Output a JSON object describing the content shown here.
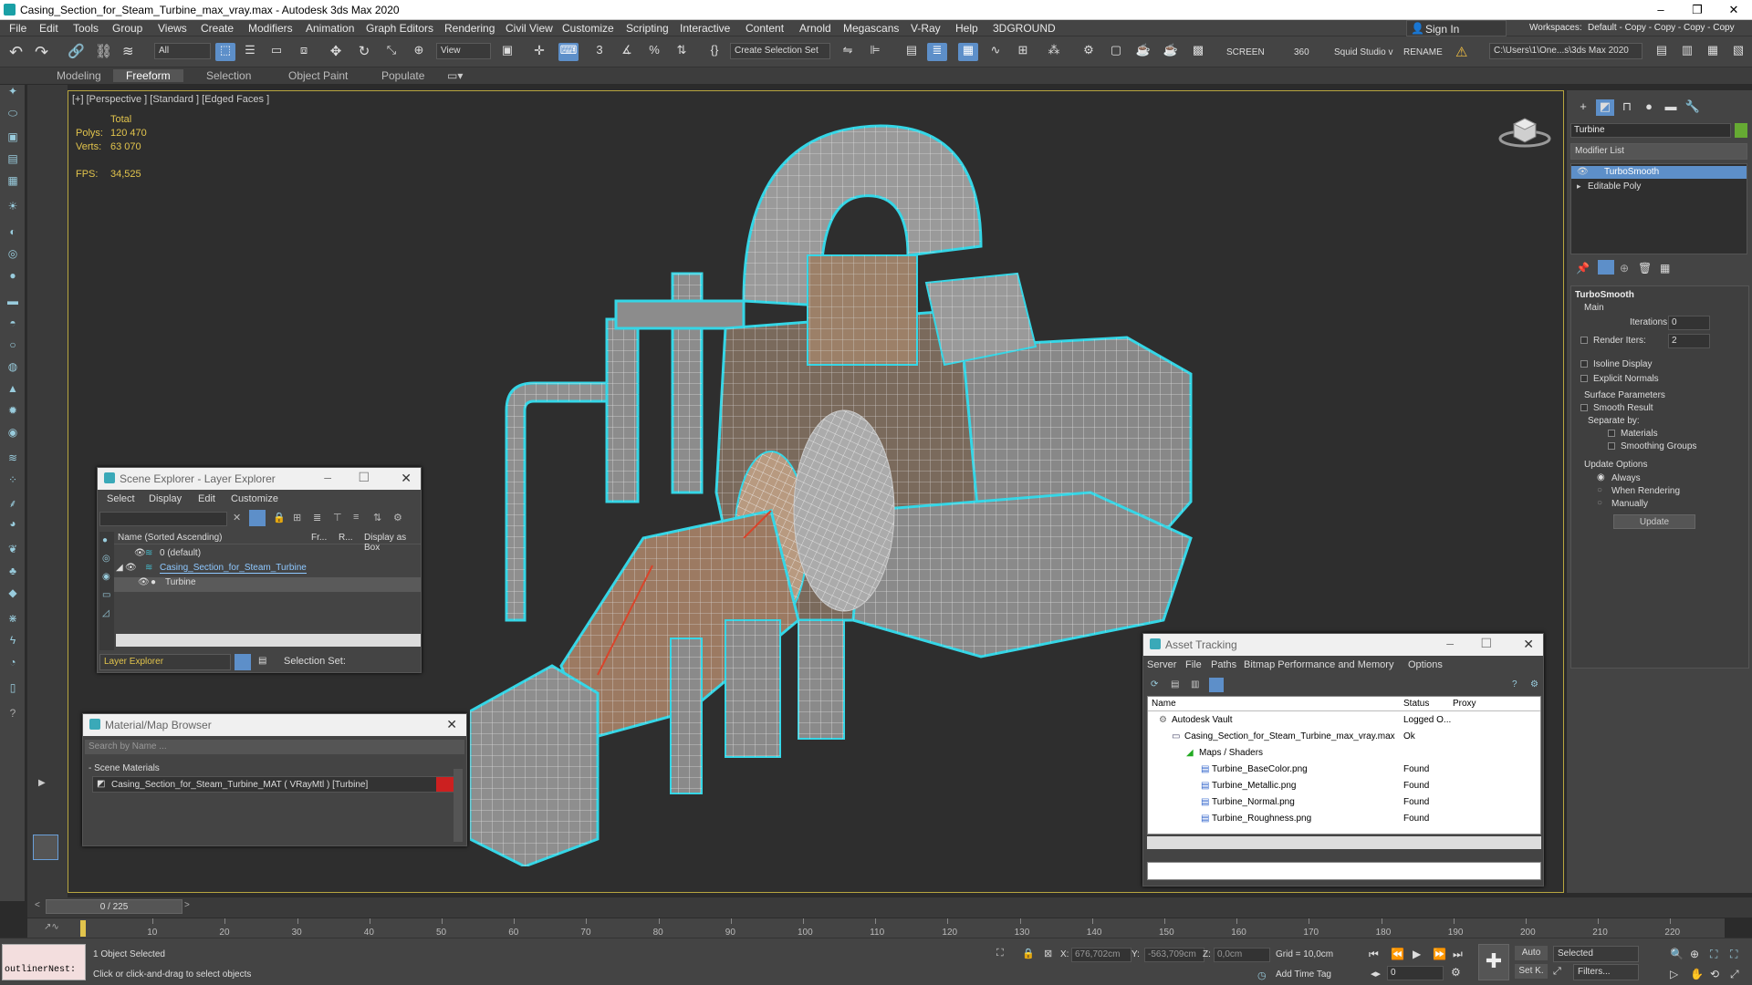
{
  "window": {
    "title": "Casing_Section_for_Steam_Turbine_max_vray.max - Autodesk 3ds Max 2020",
    "min": "–",
    "max": "❐",
    "close": "✕"
  },
  "menu": [
    "File",
    "Edit",
    "Tools",
    "Group",
    "Views",
    "Create",
    "Modifiers",
    "Animation",
    "Graph Editors",
    "Rendering",
    "Civil View",
    "Customize",
    "Scripting",
    "Interactive",
    "Content",
    "Arnold",
    "Megascans",
    "V-Ray",
    "Help",
    "3DGROUND"
  ],
  "account": {
    "sign_in": "Sign In",
    "workspaces_label": "Workspaces:",
    "workspace_value": "Default - Copy - Copy - Copy - Copy"
  },
  "toolbar": {
    "filter_value": "All",
    "view_value": "View",
    "selection_set": "Create Selection Set",
    "screen": "SCREEN",
    "num360": "360",
    "studio": "Squid Studio v",
    "rename": "RENAME",
    "path": "C:\\Users\\1\\One...s\\3ds Max 2020"
  },
  "ribbon": [
    "Modeling",
    "Freeform",
    "Selection",
    "Object Paint",
    "Populate"
  ],
  "viewport": {
    "label": "[+] [Perspective ] [Standard ] [Edged Faces ]",
    "total_label": "Total",
    "polys_label": "Polys:",
    "polys_value": "120 470",
    "verts_label": "Verts:",
    "verts_value": "63 070",
    "fps_label": "FPS:",
    "fps_value": "34,525"
  },
  "command_panel": {
    "object_name": "Turbine",
    "modifier_list": "Modifier List",
    "stack": [
      "TurboSmooth",
      "Editable Poly"
    ],
    "rollout_title": "TurboSmooth",
    "main_label": "Main",
    "iterations_label": "Iterations:",
    "iterations_value": "0",
    "render_iters_label": "Render Iters:",
    "render_iters_value": "2",
    "isoline": "Isoline Display",
    "explicit": "Explicit Normals",
    "surface_params": "Surface Parameters",
    "smooth_result": "Smooth Result",
    "separate_by": "Separate by:",
    "materials": "Materials",
    "smoothing_groups": "Smoothing Groups",
    "update_options": "Update Options",
    "always": "Always",
    "when_rendering": "When Rendering",
    "manually": "Manually",
    "update_btn": "Update"
  },
  "scene_explorer": {
    "title": "Scene Explorer - Layer Explorer",
    "menus": [
      "Select",
      "Display",
      "Edit",
      "Customize"
    ],
    "col_name": "Name (Sorted Ascending)",
    "col_fr": "Fr...",
    "col_r": "R...",
    "col_box": "Display as Box",
    "rows": [
      "0 (default)",
      "Casing_Section_for_Steam_Turbine",
      "Turbine"
    ],
    "footer_dd": "Layer Explorer",
    "selection_set": "Selection Set:"
  },
  "material_browser": {
    "title": "Material/Map Browser",
    "search_placeholder": "Search by Name ...",
    "section": "- Scene Materials",
    "item": "Casing_Section_for_Steam_Turbine_MAT  ( VRayMtl )  [Turbine]"
  },
  "asset_tracking": {
    "title": "Asset Tracking",
    "menus": [
      "Server",
      "File",
      "Paths",
      "Bitmap Performance and Memory",
      "Options"
    ],
    "col_name": "Name",
    "col_status": "Status",
    "col_proxy": "Proxy",
    "rows": [
      {
        "name": "Autodesk Vault",
        "status": "Logged O..."
      },
      {
        "name": "Casing_Section_for_Steam_Turbine_max_vray.max",
        "status": "Ok"
      },
      {
        "name": "Maps / Shaders",
        "status": ""
      },
      {
        "name": "Turbine_BaseColor.png",
        "status": "Found"
      },
      {
        "name": "Turbine_Metallic.png",
        "status": "Found"
      },
      {
        "name": "Turbine_Normal.png",
        "status": "Found"
      },
      {
        "name": "Turbine_Roughness.png",
        "status": "Found"
      }
    ]
  },
  "timeline": {
    "frame": "0 / 225",
    "ticks": [
      "10",
      "20",
      "30",
      "40",
      "50",
      "60",
      "70",
      "80",
      "90",
      "100",
      "110",
      "120",
      "130",
      "140",
      "150",
      "160",
      "170",
      "180",
      "190",
      "200",
      "210",
      "220"
    ]
  },
  "status": {
    "listener": "outlinerNest:",
    "selected": "1 Object Selected",
    "hint": "Click or click-and-drag to select objects",
    "x_label": "X:",
    "x_value": "676,702cm",
    "y_label": "Y:",
    "y_value": "-563,709cm",
    "z_label": "Z:",
    "z_value": "0,0cm",
    "grid": "Grid = 10,0cm",
    "add_time_tag": "Add Time Tag",
    "auto": "Auto",
    "selected_dd": "Selected",
    "setk": "Set K.",
    "filters": "Filters...",
    "frame_value": "0"
  },
  "colors": {
    "accent": "#4a90d9",
    "selection_outline": "#35d6e6",
    "viewport_border": "#b8a640",
    "stat_text": "#e2c44c"
  }
}
